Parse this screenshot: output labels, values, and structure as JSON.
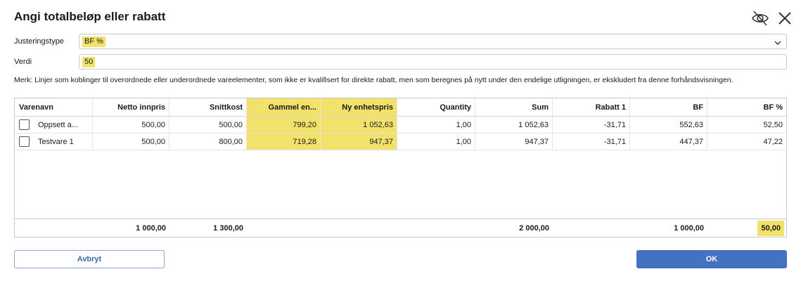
{
  "dialog": {
    "title": "Angi totalbeløp eller rabatt"
  },
  "icons": {
    "visibility": "eye-slash-icon",
    "close": "close-icon",
    "dropdown": "chevron-down-icon"
  },
  "form": {
    "type_label": "Justeringstype",
    "type_value": "BF %",
    "value_label": "Verdi",
    "value_value": "50"
  },
  "note": "Merk: Linjer som koblinger til overordnede eller underordnede vareelementer, som ikke er kvalifisert for direkte rabatt, men som beregnes på nytt under den endelige utligningen, er ekskludert fra denne forhåndsvisningen.",
  "table": {
    "columns": [
      "Varenavn",
      "Netto innpris",
      "Snittkost",
      "Gammel en...",
      "Ny enhetspris",
      "Quantity",
      "Sum",
      "Rabatt 1",
      "BF",
      "BF %"
    ],
    "rows": [
      [
        "Oppsett a...",
        "500,00",
        "500,00",
        "799,20",
        "1 052,63",
        "1,00",
        "1 052,63",
        "-31,71",
        "552,63",
        "52,50"
      ],
      [
        "Testvare 1",
        "500,00",
        "800,00",
        "719,28",
        "947,37",
        "1,00",
        "947,37",
        "-31,71",
        "447,37",
        "47,22"
      ]
    ],
    "totals": [
      "",
      "1 000,00",
      "1 300,00",
      "",
      "",
      "",
      "2 000,00",
      "",
      "1 000,00",
      "50,00"
    ]
  },
  "buttons": {
    "cancel": "Avbryt",
    "ok": "OK"
  },
  "colors": {
    "highlight": "#f2e26b",
    "primary": "#4472c0",
    "border": "#c9c9c9"
  }
}
